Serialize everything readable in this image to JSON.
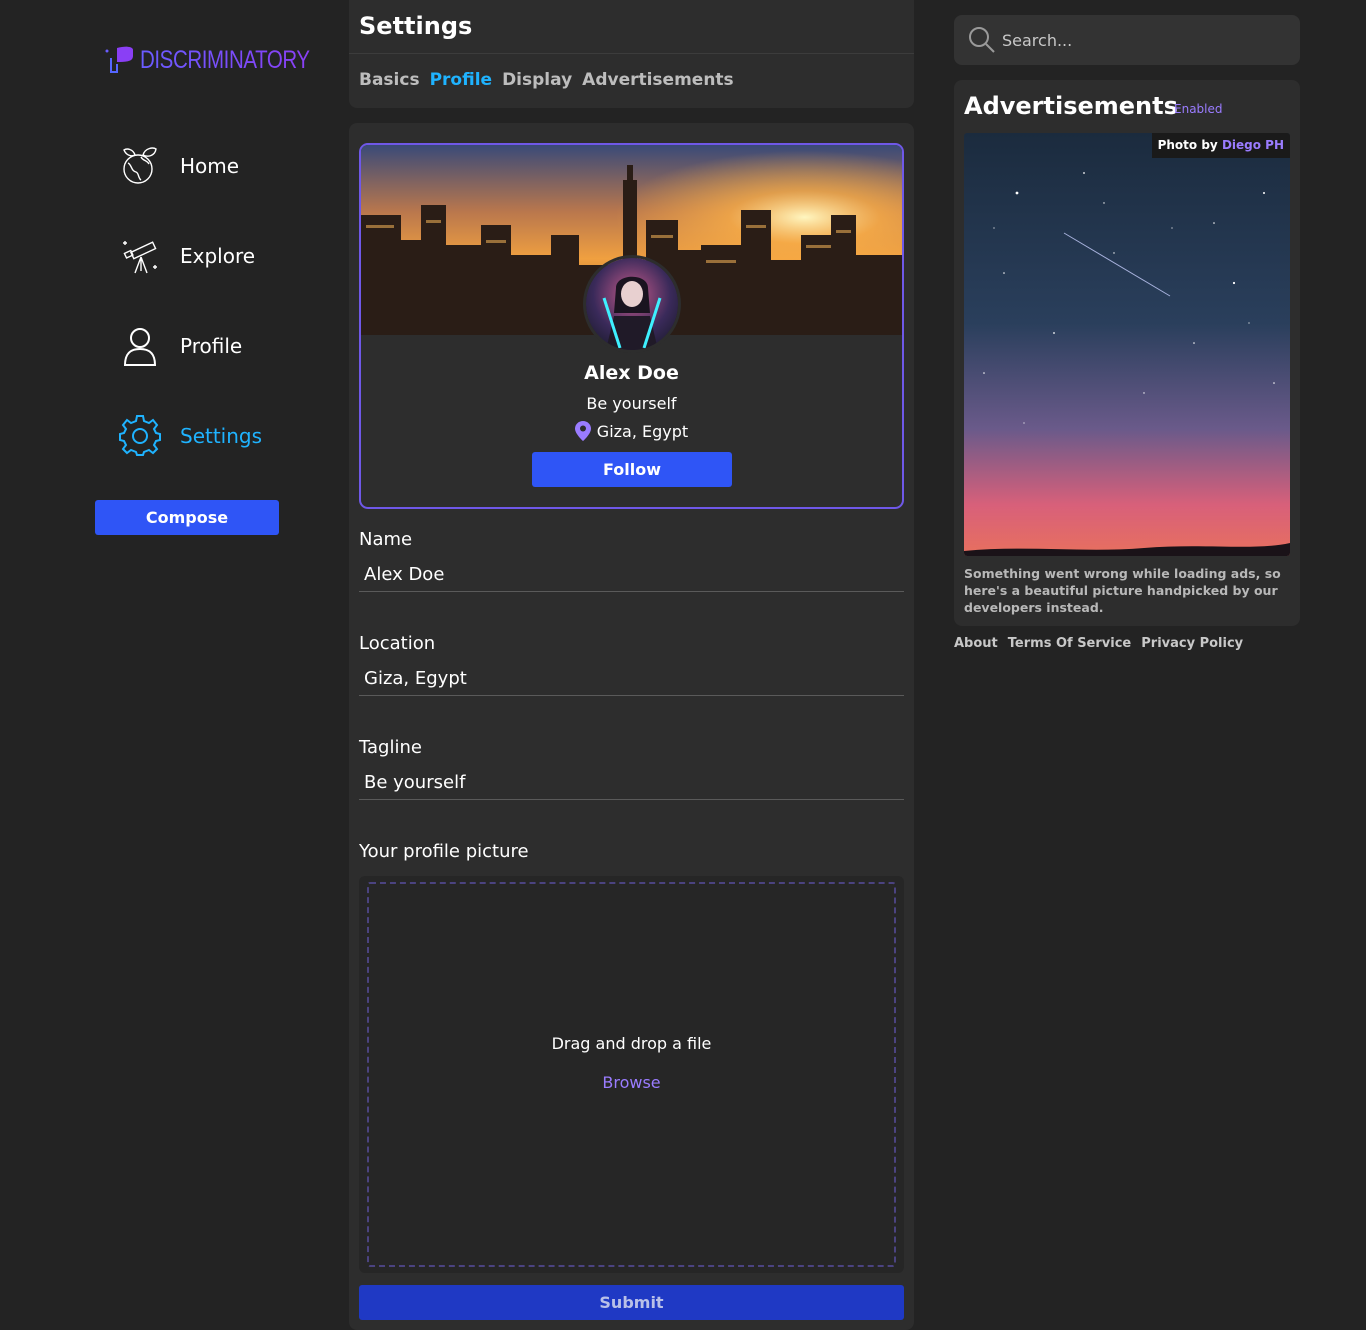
{
  "brand": {
    "name": "DISCRIMINATORY"
  },
  "nav": {
    "items": [
      {
        "label": "Home",
        "icon": "earth-leaves-icon"
      },
      {
        "label": "Explore",
        "icon": "telescope-icon"
      },
      {
        "label": "Profile",
        "icon": "user-icon"
      },
      {
        "label": "Settings",
        "icon": "gear-icon",
        "active": true
      }
    ],
    "compose_label": "Compose"
  },
  "settings": {
    "title": "Settings",
    "tabs": [
      {
        "label": "Basics"
      },
      {
        "label": "Profile",
        "active": true
      },
      {
        "label": "Display"
      },
      {
        "label": "Advertisements"
      }
    ]
  },
  "preview": {
    "name": "Alex Doe",
    "tagline": "Be yourself",
    "location": "Giza, Egypt",
    "follow_label": "Follow"
  },
  "form": {
    "name_label": "Name",
    "name_value": "Alex Doe",
    "location_label": "Location",
    "location_value": "Giza, Egypt",
    "tagline_label": "Tagline",
    "tagline_value": "Be yourself",
    "picture_label": "Your profile picture",
    "drop_text": "Drag and drop a file",
    "browse_label": "Browse",
    "submit_label": "Submit"
  },
  "search": {
    "placeholder": "Search..."
  },
  "ads": {
    "title": "Advertisements",
    "status": "Enabled",
    "credit_prefix": "Photo by",
    "credit_author": "Diego PH",
    "message": "Something went wrong while loading ads, so here's a beautiful picture handpicked by our developers instead."
  },
  "footer": {
    "links": [
      "About",
      "Terms Of Service",
      "Privacy Policy"
    ]
  },
  "colors": {
    "accent": "#1fb3ff",
    "primary_button": "#2f55f6",
    "purple": "#9a7cff",
    "background": "#232323",
    "panel": "#2d2d2d"
  }
}
